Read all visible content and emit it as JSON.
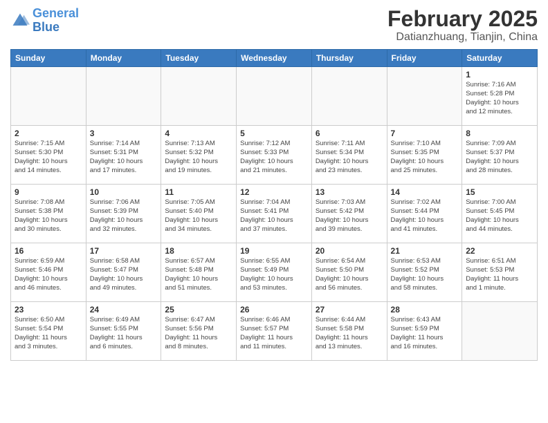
{
  "logo": {
    "line1": "General",
    "line2": "Blue"
  },
  "title": "February 2025",
  "subtitle": "Datianzhuang, Tianjin, China",
  "weekdays": [
    "Sunday",
    "Monday",
    "Tuesday",
    "Wednesday",
    "Thursday",
    "Friday",
    "Saturday"
  ],
  "weeks": [
    [
      {
        "day": "",
        "detail": ""
      },
      {
        "day": "",
        "detail": ""
      },
      {
        "day": "",
        "detail": ""
      },
      {
        "day": "",
        "detail": ""
      },
      {
        "day": "",
        "detail": ""
      },
      {
        "day": "",
        "detail": ""
      },
      {
        "day": "1",
        "detail": "Sunrise: 7:16 AM\nSunset: 5:28 PM\nDaylight: 10 hours\nand 12 minutes."
      }
    ],
    [
      {
        "day": "2",
        "detail": "Sunrise: 7:15 AM\nSunset: 5:30 PM\nDaylight: 10 hours\nand 14 minutes."
      },
      {
        "day": "3",
        "detail": "Sunrise: 7:14 AM\nSunset: 5:31 PM\nDaylight: 10 hours\nand 17 minutes."
      },
      {
        "day": "4",
        "detail": "Sunrise: 7:13 AM\nSunset: 5:32 PM\nDaylight: 10 hours\nand 19 minutes."
      },
      {
        "day": "5",
        "detail": "Sunrise: 7:12 AM\nSunset: 5:33 PM\nDaylight: 10 hours\nand 21 minutes."
      },
      {
        "day": "6",
        "detail": "Sunrise: 7:11 AM\nSunset: 5:34 PM\nDaylight: 10 hours\nand 23 minutes."
      },
      {
        "day": "7",
        "detail": "Sunrise: 7:10 AM\nSunset: 5:35 PM\nDaylight: 10 hours\nand 25 minutes."
      },
      {
        "day": "8",
        "detail": "Sunrise: 7:09 AM\nSunset: 5:37 PM\nDaylight: 10 hours\nand 28 minutes."
      }
    ],
    [
      {
        "day": "9",
        "detail": "Sunrise: 7:08 AM\nSunset: 5:38 PM\nDaylight: 10 hours\nand 30 minutes."
      },
      {
        "day": "10",
        "detail": "Sunrise: 7:06 AM\nSunset: 5:39 PM\nDaylight: 10 hours\nand 32 minutes."
      },
      {
        "day": "11",
        "detail": "Sunrise: 7:05 AM\nSunset: 5:40 PM\nDaylight: 10 hours\nand 34 minutes."
      },
      {
        "day": "12",
        "detail": "Sunrise: 7:04 AM\nSunset: 5:41 PM\nDaylight: 10 hours\nand 37 minutes."
      },
      {
        "day": "13",
        "detail": "Sunrise: 7:03 AM\nSunset: 5:42 PM\nDaylight: 10 hours\nand 39 minutes."
      },
      {
        "day": "14",
        "detail": "Sunrise: 7:02 AM\nSunset: 5:44 PM\nDaylight: 10 hours\nand 41 minutes."
      },
      {
        "day": "15",
        "detail": "Sunrise: 7:00 AM\nSunset: 5:45 PM\nDaylight: 10 hours\nand 44 minutes."
      }
    ],
    [
      {
        "day": "16",
        "detail": "Sunrise: 6:59 AM\nSunset: 5:46 PM\nDaylight: 10 hours\nand 46 minutes."
      },
      {
        "day": "17",
        "detail": "Sunrise: 6:58 AM\nSunset: 5:47 PM\nDaylight: 10 hours\nand 49 minutes."
      },
      {
        "day": "18",
        "detail": "Sunrise: 6:57 AM\nSunset: 5:48 PM\nDaylight: 10 hours\nand 51 minutes."
      },
      {
        "day": "19",
        "detail": "Sunrise: 6:55 AM\nSunset: 5:49 PM\nDaylight: 10 hours\nand 53 minutes."
      },
      {
        "day": "20",
        "detail": "Sunrise: 6:54 AM\nSunset: 5:50 PM\nDaylight: 10 hours\nand 56 minutes."
      },
      {
        "day": "21",
        "detail": "Sunrise: 6:53 AM\nSunset: 5:52 PM\nDaylight: 10 hours\nand 58 minutes."
      },
      {
        "day": "22",
        "detail": "Sunrise: 6:51 AM\nSunset: 5:53 PM\nDaylight: 11 hours\nand 1 minute."
      }
    ],
    [
      {
        "day": "23",
        "detail": "Sunrise: 6:50 AM\nSunset: 5:54 PM\nDaylight: 11 hours\nand 3 minutes."
      },
      {
        "day": "24",
        "detail": "Sunrise: 6:49 AM\nSunset: 5:55 PM\nDaylight: 11 hours\nand 6 minutes."
      },
      {
        "day": "25",
        "detail": "Sunrise: 6:47 AM\nSunset: 5:56 PM\nDaylight: 11 hours\nand 8 minutes."
      },
      {
        "day": "26",
        "detail": "Sunrise: 6:46 AM\nSunset: 5:57 PM\nDaylight: 11 hours\nand 11 minutes."
      },
      {
        "day": "27",
        "detail": "Sunrise: 6:44 AM\nSunset: 5:58 PM\nDaylight: 11 hours\nand 13 minutes."
      },
      {
        "day": "28",
        "detail": "Sunrise: 6:43 AM\nSunset: 5:59 PM\nDaylight: 11 hours\nand 16 minutes."
      },
      {
        "day": "",
        "detail": ""
      }
    ]
  ]
}
